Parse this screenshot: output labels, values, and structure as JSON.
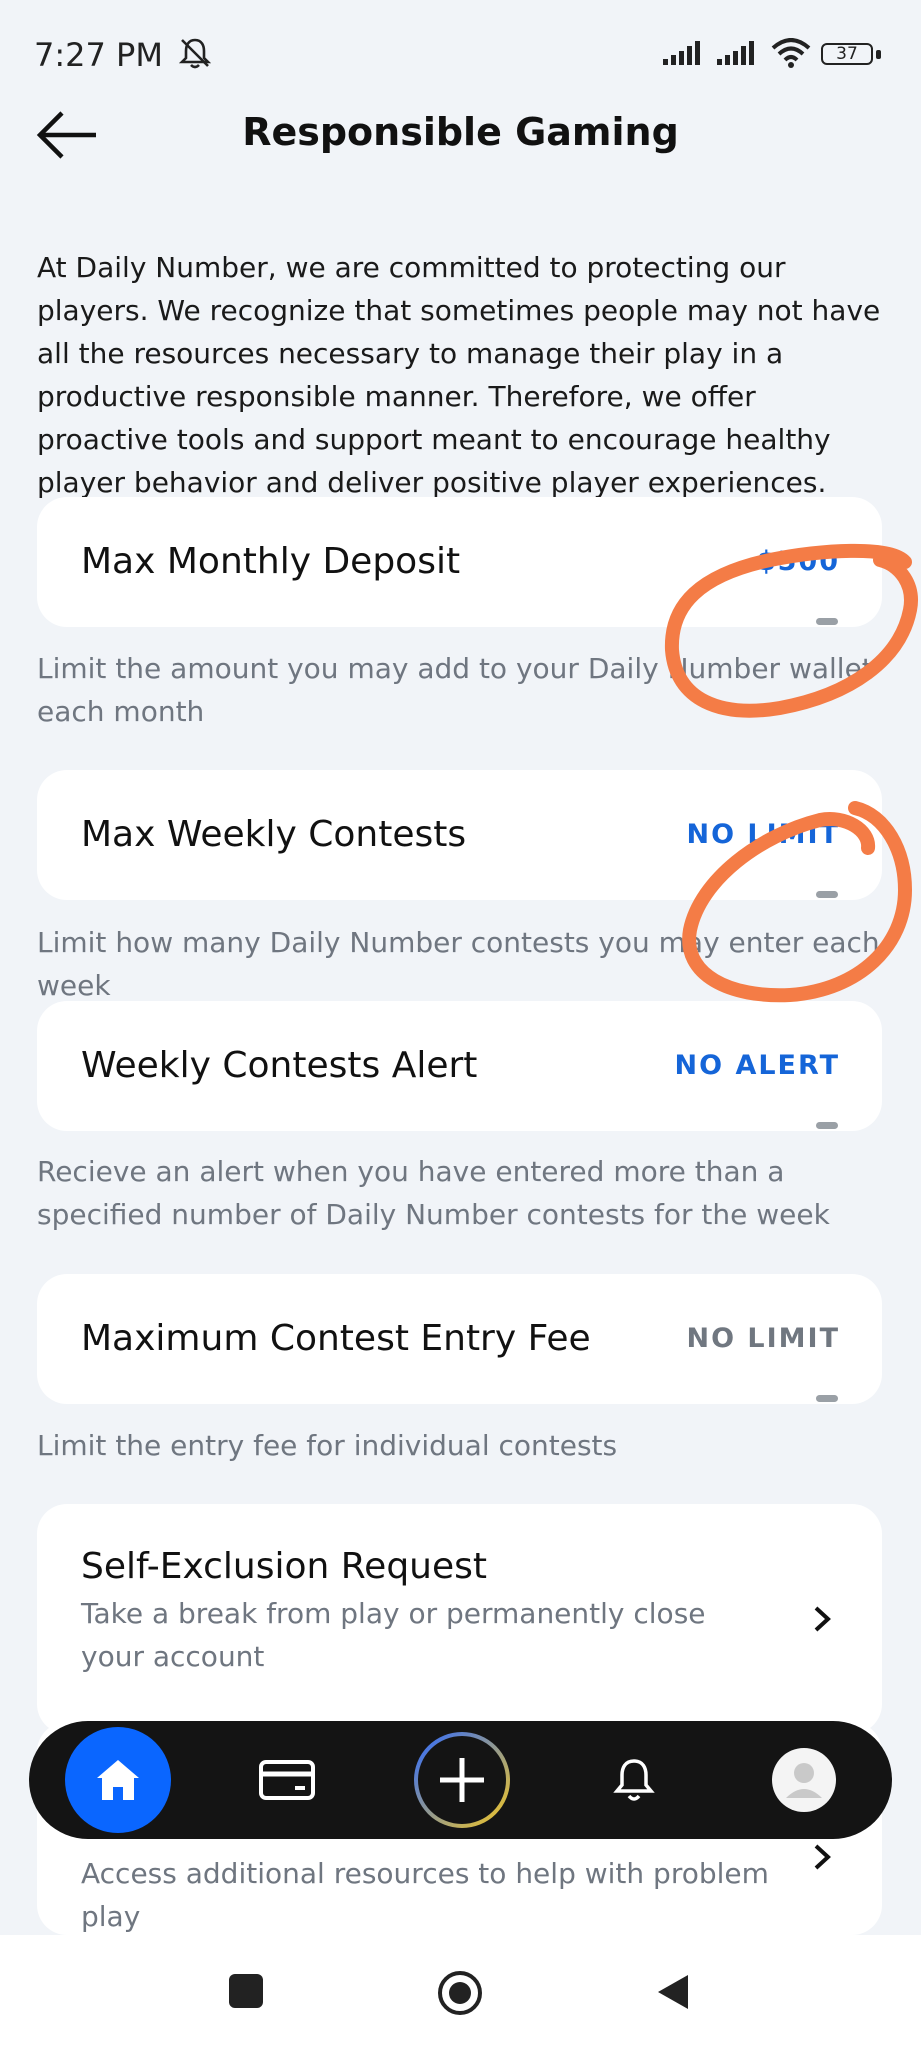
{
  "status": {
    "time": "7:27 PM",
    "battery": "37"
  },
  "header": {
    "title": "Responsible Gaming"
  },
  "intro": "At Daily Number, we are committed to protecting our players. We recognize that sometimes people may not have all the resources necessary to manage their play in a productive responsible manner. Therefore, we offer proactive tools and support meant to encourage healthy player behavior and deliver positive player experiences.",
  "settings": [
    {
      "label": "Max Monthly Deposit",
      "value": "$500",
      "description": "Limit the amount you may add to your Daily Number wallet each month"
    },
    {
      "label": "Max Weekly Contests",
      "value": "NO LIMIT",
      "description": "Limit how many Daily Number contests you may enter each week"
    },
    {
      "label": "Weekly Contests Alert",
      "value": "NO ALERT",
      "description": "Recieve an alert when you have entered more than a specified number of Daily Number contests for the week"
    },
    {
      "label": "Maximum Contest Entry Fee",
      "value": "NO LIMIT",
      "description": "Limit the entry fee for individual contests"
    }
  ],
  "self_exclusion": {
    "title": "Self-Exclusion Request",
    "subtitle": "Take a break from play or permanently close your account"
  },
  "resources": {
    "subtitle": "Access additional resources to help with problem play"
  },
  "nav": [
    "home-icon",
    "wallet-icon",
    "add-icon",
    "bell-icon",
    "profile-icon"
  ],
  "colors": {
    "accent": "#1565d8",
    "nav_home": "#0a66ff",
    "annotation": "#f47c46"
  }
}
